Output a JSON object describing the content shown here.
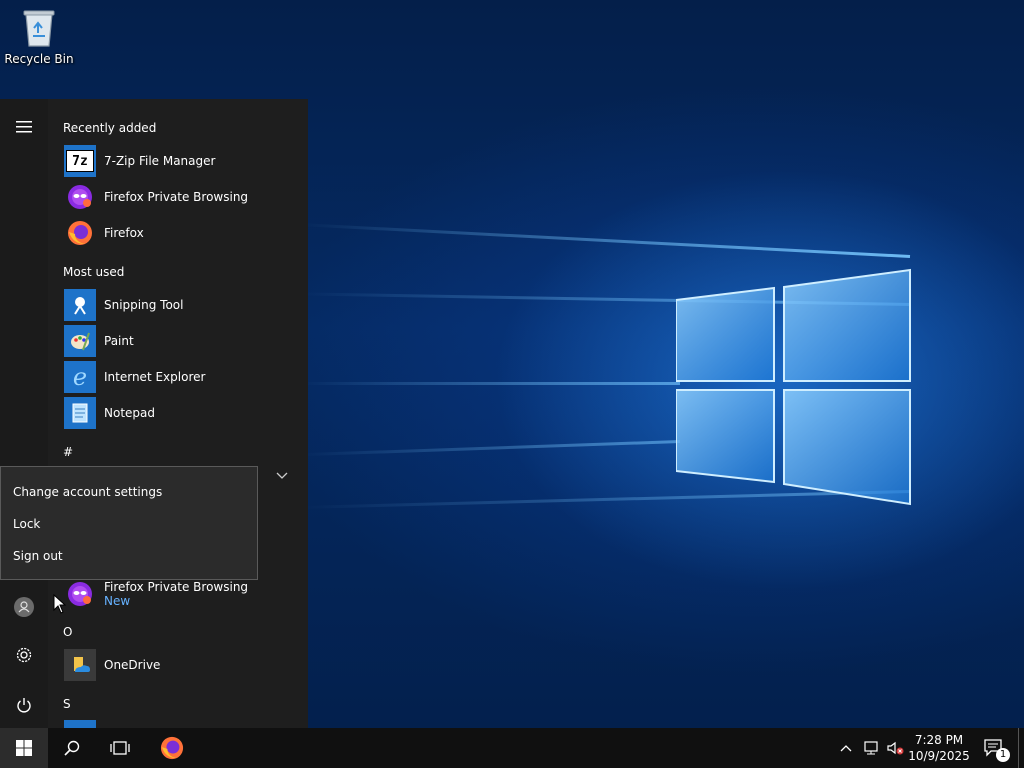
{
  "desktop": {
    "icons": [
      {
        "label": "Recycle Bin",
        "icon": "recycle-bin-icon"
      }
    ]
  },
  "start_menu": {
    "sections": {
      "recently_added": "Recently added",
      "most_used": "Most used",
      "hash": "#",
      "o": "O",
      "s": "S"
    },
    "recently_added": [
      {
        "label": "7-Zip File Manager",
        "icon": "7zip-icon"
      },
      {
        "label": "Firefox Private Browsing",
        "icon": "firefox-private-icon"
      },
      {
        "label": "Firefox",
        "icon": "firefox-icon"
      }
    ],
    "most_used": [
      {
        "label": "Snipping Tool",
        "icon": "snipping-tool-icon"
      },
      {
        "label": "Paint",
        "icon": "paint-icon"
      },
      {
        "label": "Internet Explorer",
        "icon": "internet-explorer-icon"
      },
      {
        "label": "Notepad",
        "icon": "notepad-icon"
      }
    ],
    "f_apps": [
      {
        "label": "Firefox Private Browsing",
        "badge": "New",
        "icon": "firefox-private-icon"
      }
    ],
    "o_apps": [
      {
        "label": "OneDrive",
        "icon": "onedrive-icon"
      }
    ],
    "account_menu": {
      "items": [
        "Change account settings",
        "Lock",
        "Sign out"
      ]
    }
  },
  "taskbar": {
    "pinned": [
      {
        "label": "Firefox",
        "icon": "firefox-icon"
      }
    ],
    "time": "7:28 PM",
    "date": "10/9/2025",
    "notification_count": "1"
  },
  "colors": {
    "accent": "#0078d7",
    "start_bg": "#1e1e1e",
    "taskbar_bg": "#101010",
    "new_badge": "#66b2ff"
  }
}
